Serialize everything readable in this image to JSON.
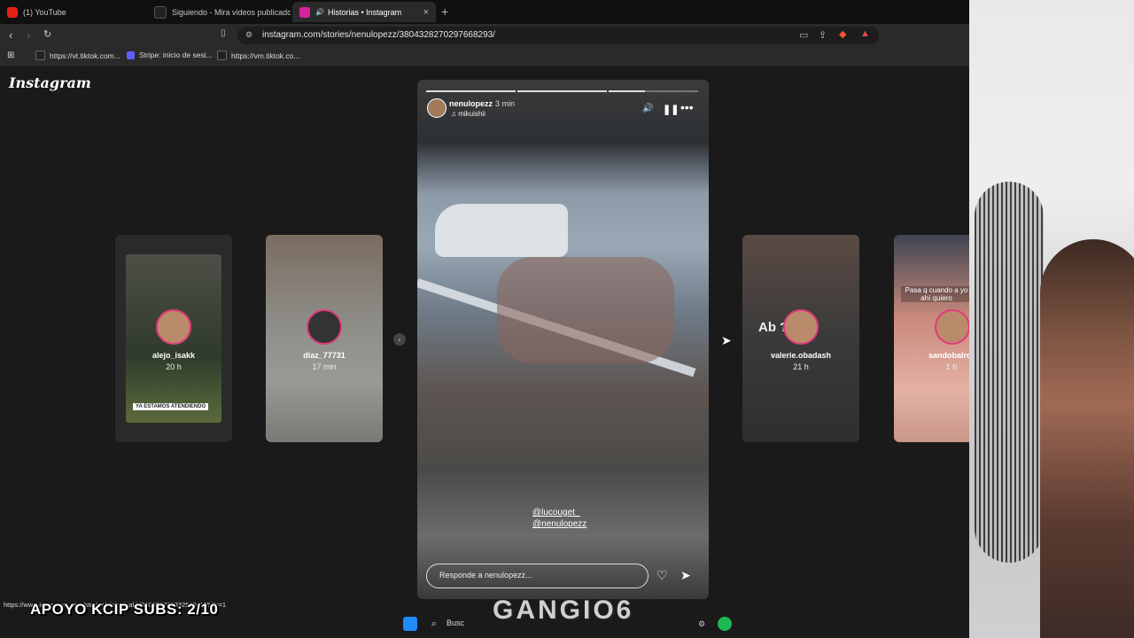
{
  "tabs": [
    {
      "label": "(1) YouTube",
      "color": "#e62117"
    },
    {
      "label": "Siguiendo - Mira videos publicados",
      "color": "#222222"
    },
    {
      "label": "Historias • Instagram",
      "color": "#d6249f",
      "close": "×"
    }
  ],
  "newtab": "+",
  "url": "instagram.com/stories/nenulopezz/3804328270297668293/",
  "bookmarks": [
    "https://vt.tiktok.com...",
    "Stripe: inicio de sesi...",
    "https://vm.tiktok.co..."
  ],
  "logo": "Instagram",
  "side_stories": [
    {
      "user": "alejo_isakk",
      "time": "20 h",
      "bg": "#3f4a3a",
      "caption": "YA ESTAMOS ATENDIENDO"
    },
    {
      "user": "diaz_77731",
      "time": "17 min",
      "bg": "#6b6b66"
    },
    {
      "user": "valerie.obadash",
      "time": "21 h",
      "bg": "#4a4a4a",
      "overlay_text": "Ab ???"
    },
    {
      "user": "sandobalroci",
      "time": "1 h",
      "bg": "#c98a7c",
      "overlay_text": "Pasa q cuando a yo ahí quiero"
    }
  ],
  "story": {
    "user": "nenulopezz",
    "time": "3 min",
    "music": "mikuishii",
    "tags": [
      "@lucouget_",
      "@nenulopezz"
    ],
    "reply_placeholder": "Responde a nenulopezz..."
  },
  "status_url": "https://www.instagram.com/stories/alejo_isakk/3803702303325491155/?r=1",
  "overlay_subs": "APOYO KCIP SUBS: 2/10",
  "overlay_brand": "GANGIO6",
  "taskbar_search": "Busc"
}
